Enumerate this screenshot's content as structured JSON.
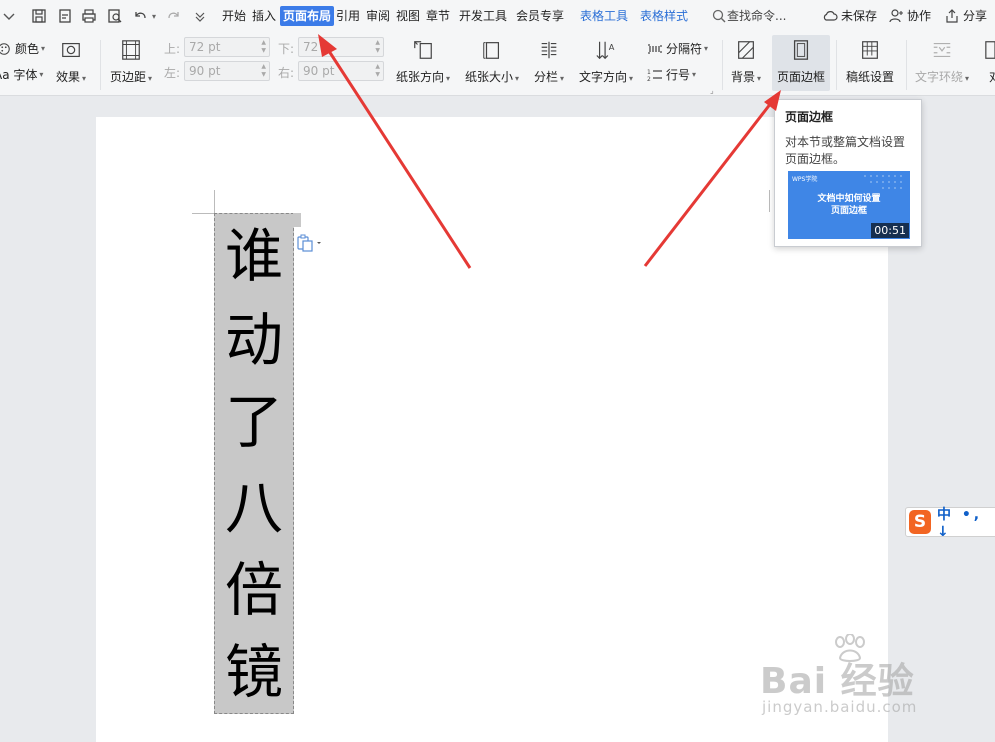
{
  "menubar": {
    "tabs": [
      "开始",
      "插入",
      "页面布局",
      "引用",
      "审阅",
      "视图",
      "章节",
      "开发工具",
      "会员专享"
    ],
    "active_tab": "页面布局",
    "context_tabs": [
      "表格工具",
      "表格样式"
    ],
    "search_placeholder": "查找命令...",
    "unsaved_label": "未保存",
    "collab_label": "协作",
    "share_label": "分享"
  },
  "ribbon": {
    "color_label": "颜色",
    "font_label": "字体",
    "font_prefix": "Aa",
    "effect_label": "效果",
    "margin_label": "页边距",
    "top_label": "上:",
    "top_value": "72 pt",
    "bottom_label": "下:",
    "bottom_value": "72",
    "left_label": "左:",
    "left_value": "90 pt",
    "right_label": "右:",
    "right_value": "90 pt",
    "orientation_label": "纸张方向",
    "size_label": "纸张大小",
    "columns_label": "分栏",
    "text_direction_label": "文字方向",
    "separator_label": "分隔符",
    "line_number_label": "行号",
    "background_label": "背景",
    "page_border_label": "页面边框",
    "manuscript_label": "稿纸设置",
    "text_wrap_label": "文字环绕",
    "align_label": "对"
  },
  "document": {
    "vertical_text": [
      "谁",
      "动",
      "了",
      "八",
      "倍",
      "镜"
    ]
  },
  "tooltip": {
    "title": "页面边框",
    "description": "对本节或整篇文档设置页面边框。",
    "thumb_brand": "WPS学院",
    "thumb_text_line1": "文档中如何设置",
    "thumb_text_line2": "页面边框",
    "duration": "00:51"
  },
  "ime": {
    "logo": "S",
    "text": "中 •, ↓"
  },
  "watermark": {
    "main": "Bai 经验",
    "sub": "jingyan.baidu.com"
  },
  "colors": {
    "accent": "#3b7be8",
    "arrow": "#e53935",
    "ime_orange": "#f26522"
  }
}
